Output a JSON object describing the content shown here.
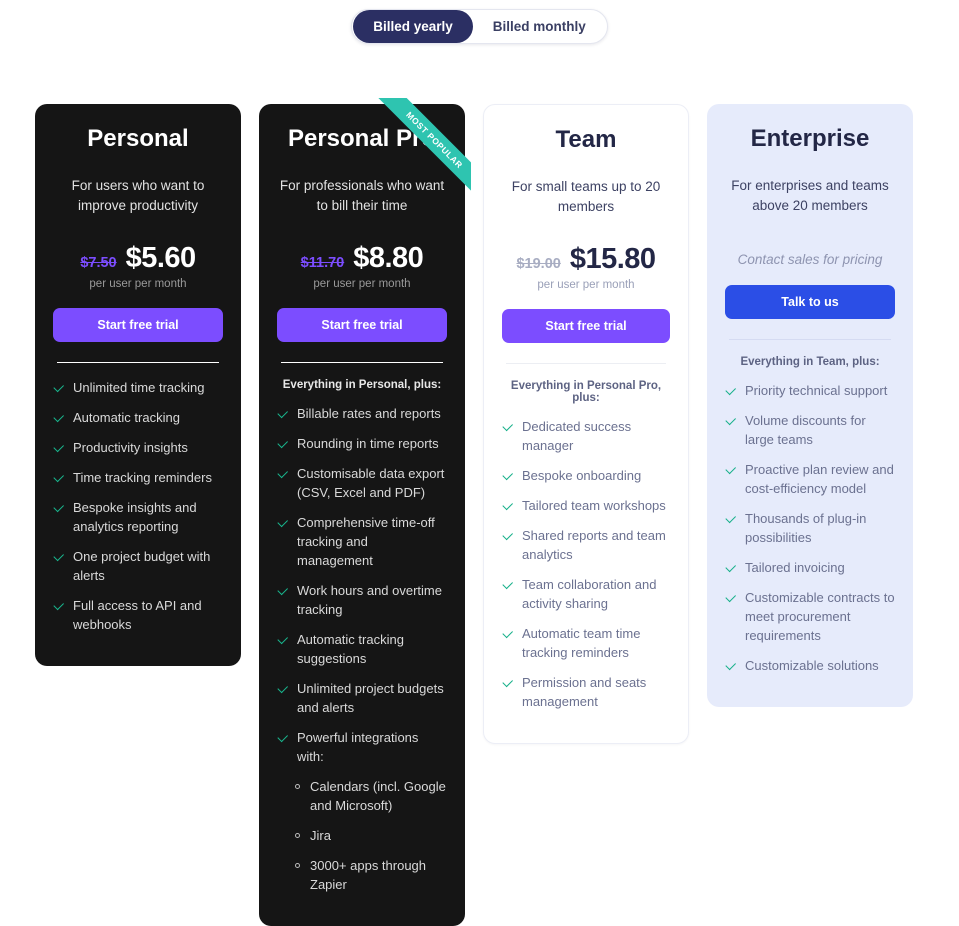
{
  "billing_toggle": {
    "options": [
      {
        "label": "Billed yearly",
        "active": true
      },
      {
        "label": "Billed monthly",
        "active": false
      }
    ]
  },
  "colors": {
    "accent_purple": "#7c4dff",
    "accent_blue": "#2b4ee6",
    "ribbon_teal": "#2ec4b0",
    "check_green": "#19b58d",
    "dark_card": "#151515",
    "blue_card": "#e6ebfb",
    "toggle_active": "#2b2f63"
  },
  "price_unit_label": "per user per month",
  "plans": [
    {
      "name": "Personal",
      "theme": "dark",
      "description": "For users who want to improve productivity",
      "price_old": "$7.50",
      "price_new": "$5.60",
      "cta_label": "Start free trial",
      "cta_style": "purple",
      "includes_header": null,
      "ribbon": null,
      "features": [
        "Unlimited time tracking",
        "Automatic tracking",
        "Productivity insights",
        "Time tracking reminders",
        "Bespoke insights and analytics reporting",
        "One project budget with alerts",
        "Full access to API and webhooks"
      ],
      "subfeatures": []
    },
    {
      "name": "Personal Pro",
      "theme": "dark",
      "description": "For professionals who want to bill their time",
      "price_old": "$11.70",
      "price_new": "$8.80",
      "cta_label": "Start free trial",
      "cta_style": "purple",
      "includes_header": "Everything in Personal, plus:",
      "ribbon": "MOST POPULAR",
      "features": [
        "Billable rates and reports",
        "Rounding in time reports",
        "Customisable data export (CSV, Excel and PDF)",
        "Comprehensive time-off tracking and management",
        "Work hours and overtime tracking",
        "Automatic tracking suggestions",
        "Unlimited project budgets and alerts",
        "Powerful integrations with:"
      ],
      "subfeatures": [
        "Calendars (incl. Google and Microsoft)",
        "Jira",
        "3000+ apps through Zapier"
      ]
    },
    {
      "name": "Team",
      "theme": "light",
      "description": "For small teams up to 20 members",
      "price_old": "$19.00",
      "price_new": "$15.80",
      "cta_label": "Start free trial",
      "cta_style": "purple",
      "includes_header": "Everything in Personal Pro, plus:",
      "ribbon": null,
      "features": [
        "Dedicated success manager",
        "Bespoke onboarding",
        "Tailored team workshops",
        "Shared reports and team analytics",
        "Team collaboration and activity sharing",
        "Automatic team time tracking reminders",
        "Permission and seats management"
      ],
      "subfeatures": []
    },
    {
      "name": "Enterprise",
      "theme": "blue",
      "description": "For enterprises and teams above 20 members",
      "price_old": null,
      "price_new": null,
      "contact_note": "Contact sales for pricing",
      "cta_label": "Talk to us",
      "cta_style": "blue",
      "includes_header": "Everything in Team, plus:",
      "ribbon": null,
      "features": [
        "Priority technical support",
        "Volume discounts for large teams",
        "Proactive plan review and cost-efficiency model",
        "Thousands of plug-in possibilities",
        "Tailored invoicing",
        "Customizable contracts to meet procurement requirements",
        "Customizable solutions"
      ],
      "subfeatures": []
    }
  ]
}
